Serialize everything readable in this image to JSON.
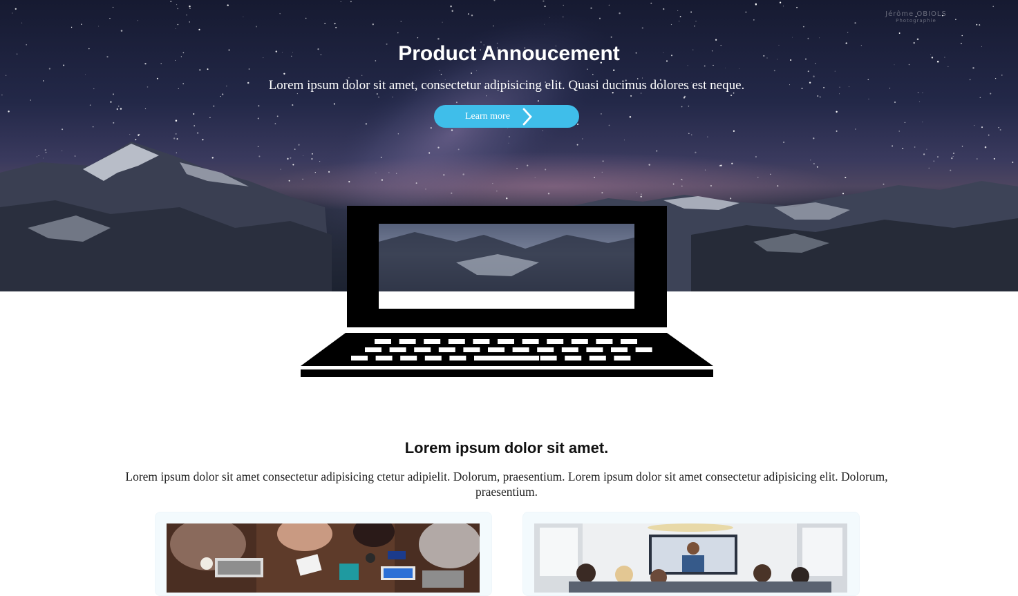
{
  "hero": {
    "watermark_line1": "Jérôme OBIOLS",
    "watermark_line2": "Photographie",
    "title": "Product Annoucement",
    "subtitle": "Lorem ipsum dolor sit amet, consectetur adipisicing elit. Quasi ducimus dolores est neque.",
    "button_label": "Learn more",
    "button_icon": "chevron-right-icon",
    "accent_color": "#3fbeea"
  },
  "section": {
    "title": "Lorem ipsum dolor sit amet.",
    "text": "Lorem ipsum dolor sit amet consectetur adipisicing ctetur adipielit. Dolorum, praesentium. Lorem ipsum dolor sit amet consectetur adipisicing elit. Dolorum, praesentium."
  },
  "cards": [
    {
      "image": "team-meeting-photo"
    },
    {
      "image": "video-conference-photo"
    }
  ]
}
